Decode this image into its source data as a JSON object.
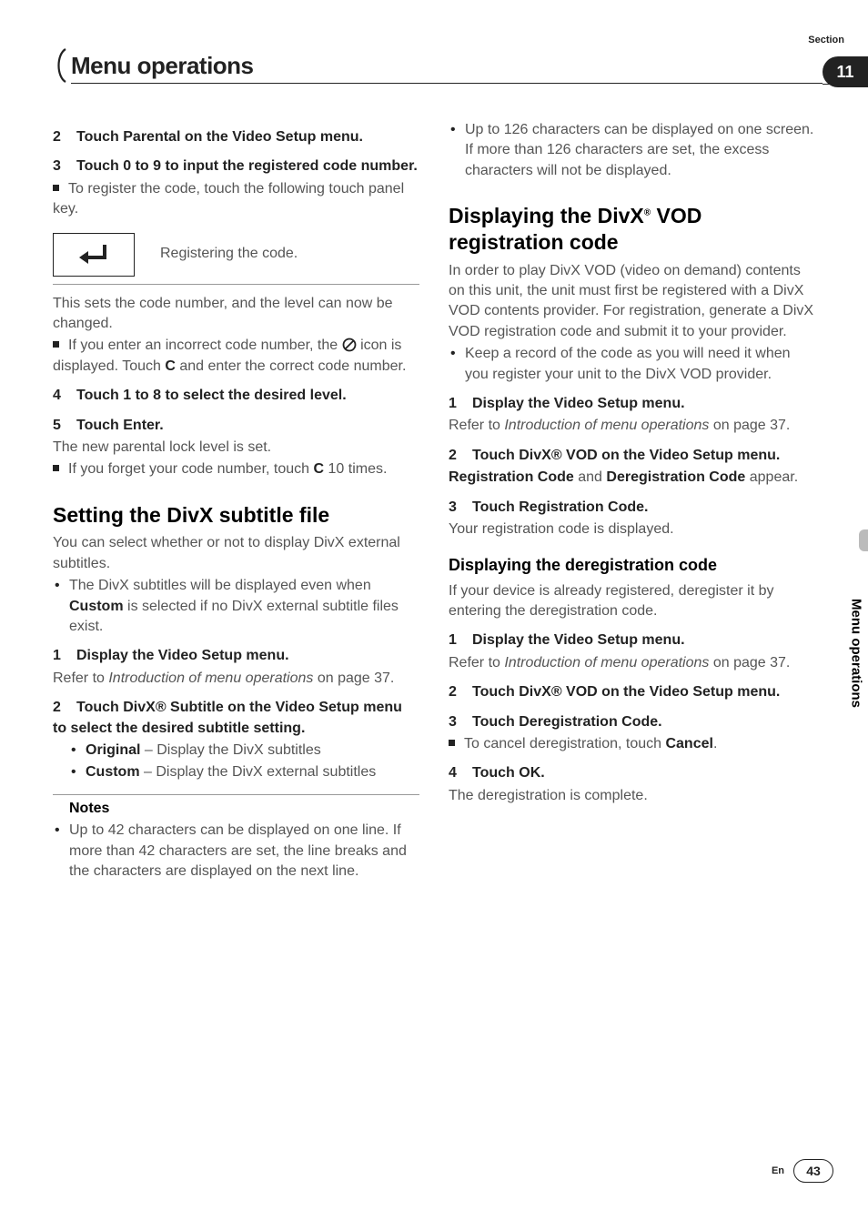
{
  "header": {
    "section_label": "Section",
    "title": "Menu operations",
    "section_number": "11"
  },
  "left": {
    "step2": "2",
    "step2_text": "Touch Parental on the Video Setup menu.",
    "step3": "3",
    "step3_text": "Touch 0 to 9 to input the registered code number.",
    "step3_bullet": "To register the code, touch the following touch panel key.",
    "key_caption": "Registering the code.",
    "after_key_p": "This sets the code number, and the level can now be changed.",
    "err_pre": "If you enter an incorrect code number, the ",
    "err_post1": " icon is displayed. Touch ",
    "err_bold": "C",
    "err_post2": " and enter the correct code number.",
    "step4": "4",
    "step4_text": "Touch 1 to 8 to select the desired level.",
    "step5": "5",
    "step5_text": "Touch Enter.",
    "step5_p": "The new parental lock level is set.",
    "forget_pre": "If you forget your code number, touch ",
    "forget_bold": "C",
    "forget_post": " 10 times.",
    "h2_divx": "Setting the DivX subtitle file",
    "divx_intro": "You can select whether or not to display DivX external subtitles.",
    "divx_li_pre": "The DivX subtitles will be displayed even when ",
    "divx_li_bold": "Custom",
    "divx_li_post": " is selected if no DivX external subtitle files exist.",
    "d_step1": "1",
    "d_step1_text": "Display the Video Setup menu.",
    "refer_pre": "Refer to ",
    "refer_it": "Introduction of menu operations",
    "refer_post": " on page 37.",
    "d_step2": "2",
    "d_step2_text": "Touch DivX® Subtitle on the Video Setup menu to select the desired subtitle setting.",
    "opt_orig_b": "Original",
    "opt_orig_t": " – Display the DivX subtitles",
    "opt_cust_b": "Custom",
    "opt_cust_t": " – Display the DivX external subtitles",
    "notes_head": "Notes",
    "note1": "Up to 42 characters can be displayed on one line. If more than 42 characters are set, the line breaks and the characters are displayed on the next line."
  },
  "right": {
    "note2": "Up to 126 characters can be displayed on one screen. If more than 126 characters are set, the excess characters will not be displayed.",
    "h2_vod_a": "Displaying the DivX",
    "h2_vod_sup": "®",
    "h2_vod_b": " VOD registration code",
    "vod_intro": "In order to play DivX VOD (video on demand) contents on this unit, the unit must first be registered with a DivX VOD contents provider. For registration, generate a DivX VOD registration code and submit it to your provider.",
    "vod_li": "Keep a record of the code as you will need it when you register your unit to the DivX VOD provider.",
    "v1": "1",
    "v1_text": "Display the Video Setup menu.",
    "v2": "2",
    "v2_text": "Touch DivX® VOD on the Video Setup menu.",
    "v2_p_a": "Registration Code",
    "v2_p_mid": " and ",
    "v2_p_b": "Deregistration Code",
    "v2_p_end": " appear.",
    "v3": "3",
    "v3_text": "Touch Registration Code.",
    "v3_p": "Your registration code is displayed.",
    "h3_dereg": "Displaying the deregistration code",
    "dereg_intro": "If your device is already registered, deregister it by entering the deregistration code.",
    "dv1": "1",
    "dv1_text": "Display the Video Setup menu.",
    "dv2": "2",
    "dv2_text": "Touch DivX® VOD on the Video Setup menu.",
    "dv3": "3",
    "dv3_text": "Touch Deregistration Code.",
    "dv3_b_pre": "To cancel deregistration, touch ",
    "dv3_b_bold": "Cancel",
    "dv3_b_post": ".",
    "dv4": "4",
    "dv4_text": "Touch OK.",
    "dv4_p": "The deregistration is complete."
  },
  "side_tab": "Menu operations",
  "footer": {
    "lang": "En",
    "page": "43"
  }
}
